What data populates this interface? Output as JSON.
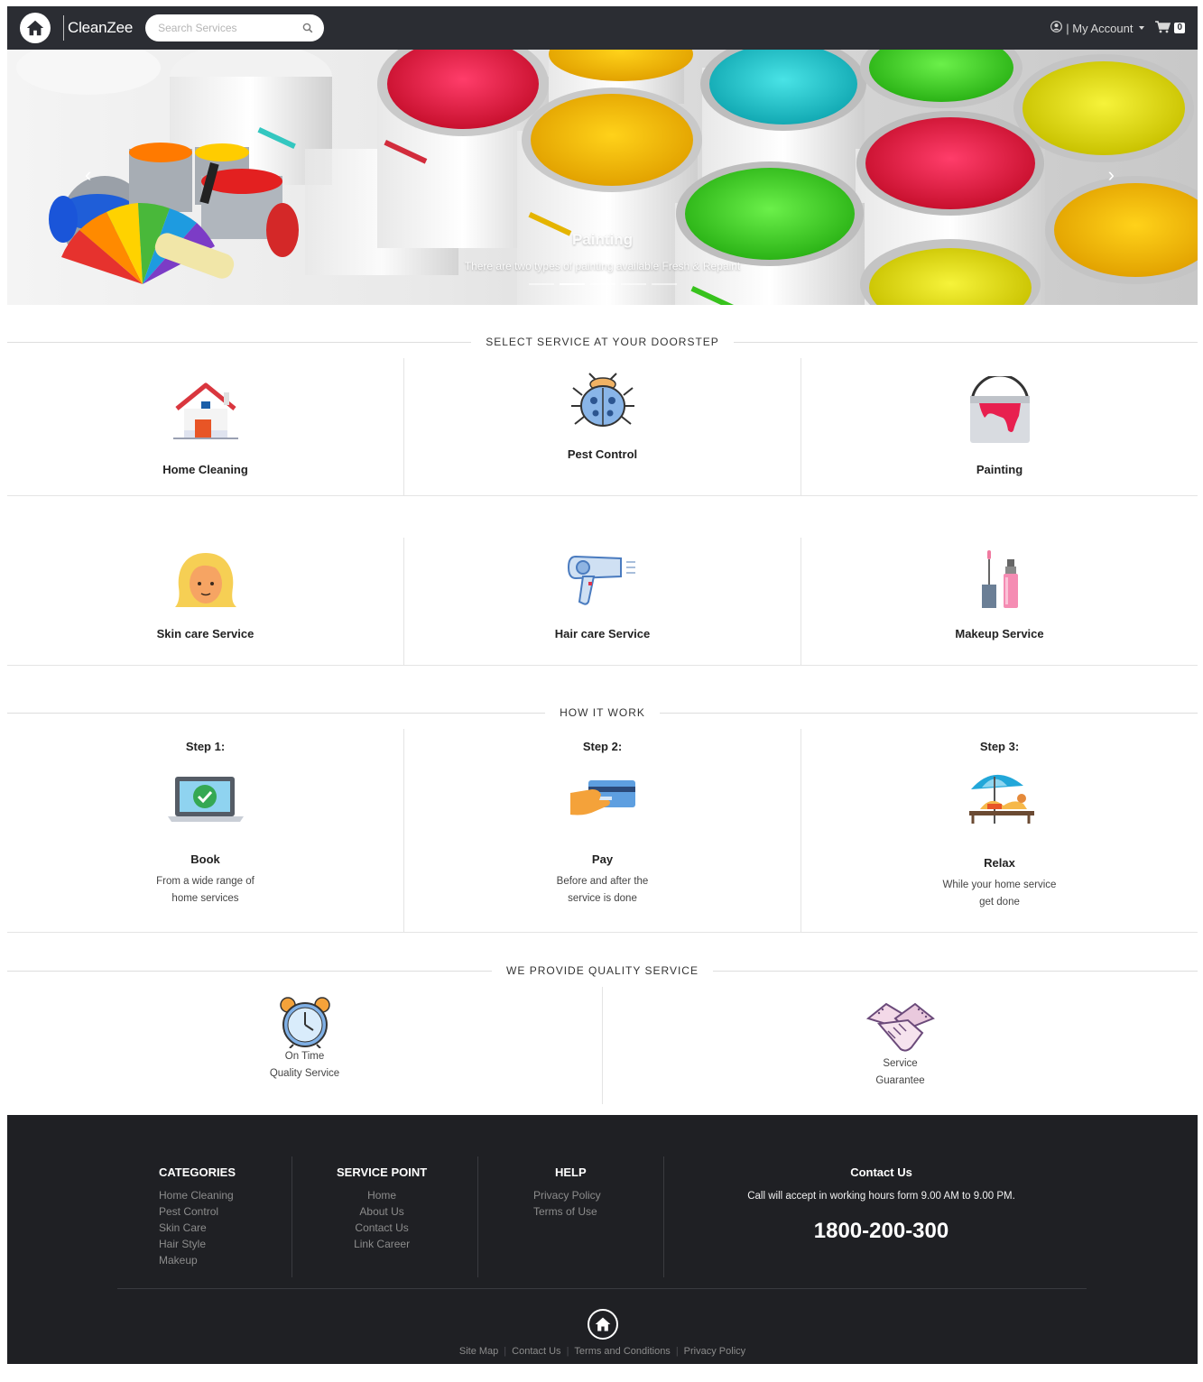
{
  "nav": {
    "brand": "CleanZee",
    "search_placeholder": "Search Services",
    "account_label": "| My Account",
    "cart_count": "0"
  },
  "hero": {
    "title": "Painting",
    "subtitle": "There are two types of painting available Fresh & Repaint",
    "slide_count": 5,
    "active_slide": 2
  },
  "services_section": {
    "heading": "SELECT SERVICE AT YOUR DOORSTEP",
    "items": [
      {
        "name": "Home Cleaning",
        "icon": "house-icon"
      },
      {
        "name": "Pest Control",
        "icon": "bug-icon"
      },
      {
        "name": "Painting",
        "icon": "paint-bucket-icon"
      },
      {
        "name": "Skin care Service",
        "icon": "woman-face-icon"
      },
      {
        "name": "Hair care Service",
        "icon": "hair-dryer-icon"
      },
      {
        "name": "Makeup Service",
        "icon": "makeup-icon"
      }
    ]
  },
  "how_section": {
    "heading": "HOW IT WORK",
    "steps": [
      {
        "step": "Step 1:",
        "label": "Book",
        "desc": "From a wide range of home services",
        "icon": "laptop-check-icon"
      },
      {
        "step": "Step 2:",
        "label": "Pay",
        "desc": "Before and after the service is done",
        "icon": "card-payment-icon"
      },
      {
        "step": "Step 3:",
        "label": "Relax",
        "desc": "While your home service get done",
        "icon": "beach-umbrella-icon"
      }
    ]
  },
  "quality_section": {
    "heading": "WE PROVIDE QUALITY SERVICE",
    "items": [
      {
        "line1": "On Time",
        "line2": "Quality Service",
        "icon": "alarm-clock-icon"
      },
      {
        "line1": "Service",
        "line2": "Guarantee",
        "icon": "handshake-icon"
      }
    ]
  },
  "footer": {
    "categories": {
      "title": "CATEGORIES",
      "links": [
        "Home Cleaning",
        "Pest Control",
        "Skin Care",
        "Hair Style",
        "Makeup"
      ]
    },
    "service_point": {
      "title": "SERVICE POINT",
      "links": [
        "Home",
        "About Us",
        "Contact Us",
        "Link Career"
      ]
    },
    "help": {
      "title": "HELP",
      "links": [
        "Privacy Policy",
        "Terms of Use"
      ]
    },
    "contact": {
      "title": "Contact Us",
      "hours": "Call will accept in working hours form 9.00 AM to 9.00 PM.",
      "phone": "1800-200-300"
    },
    "bottom_links": [
      "Site Map",
      "Contact Us",
      "Terms and Conditions",
      "Privacy Policy"
    ]
  },
  "colors": {
    "navbar": "#2b2d33",
    "footer": "#1f2024",
    "accent_red": "#d9363e"
  }
}
